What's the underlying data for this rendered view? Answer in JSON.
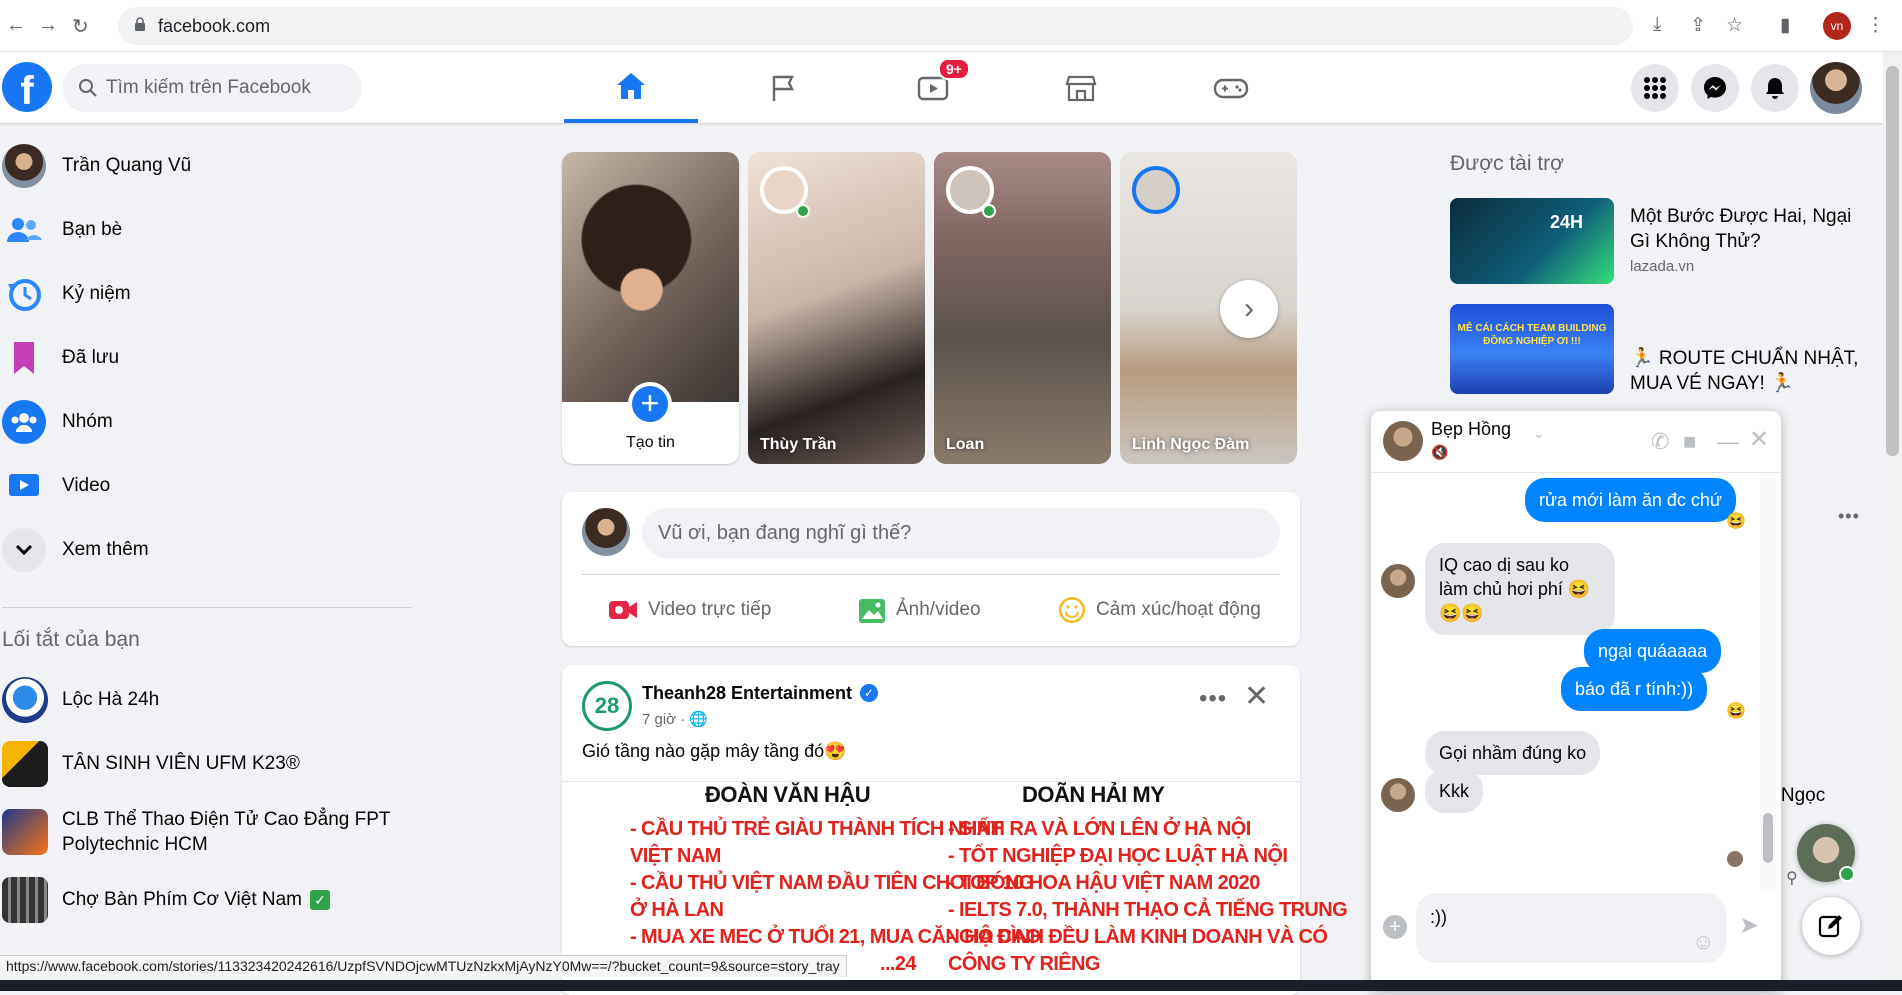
{
  "browser": {
    "url": "facebook.com",
    "profile_initials": "vn",
    "status_url": "https://www.facebook.com/stories/113323420242616/UzpfSVNDOjcwMTUzNzkxMjAyNzY0Mw==/?bucket_count=9&source=story_tray"
  },
  "topbar": {
    "search_placeholder": "Tìm kiếm trên Facebook",
    "video_badge": "9+",
    "logo_letter": "f"
  },
  "sidebar": {
    "items": [
      {
        "label": "Trần Quang Vũ",
        "icon": "profile-avatar"
      },
      {
        "label": "Bạn bè",
        "icon": "friends-icon"
      },
      {
        "label": "Kỷ niệm",
        "icon": "memories-icon"
      },
      {
        "label": "Đã lưu",
        "icon": "saved-icon"
      },
      {
        "label": "Nhóm",
        "icon": "groups-icon"
      },
      {
        "label": "Video",
        "icon": "video-icon"
      },
      {
        "label": "Xem thêm",
        "icon": "chevron-down-icon"
      }
    ],
    "shortcuts_title": "Lối tắt của bạn",
    "shortcuts": [
      {
        "label": "Lộc Hà 24h"
      },
      {
        "label": "TÂN SINH VIÊN UFM K23®"
      },
      {
        "label": "CLB Thể Thao Điện Tử Cao Đẳng FPT Polytechnic HCM"
      },
      {
        "label": "Chợ Bàn Phím Cơ Việt Nam"
      }
    ]
  },
  "stories": {
    "create_label": "Tạo tin",
    "items": [
      {
        "name": "Thùy Trần"
      },
      {
        "name": "Loan"
      },
      {
        "name": "Linh Ngọc Đàm"
      }
    ]
  },
  "composer": {
    "placeholder": "Vũ ơi, bạn đang nghĩ gì thế?",
    "actions": [
      "Video trực tiếp",
      "Ảnh/video",
      "Cảm xúc/hoạt động"
    ]
  },
  "post": {
    "author": "Theanh28 Entertainment",
    "avatar_text": "28",
    "time": "7 giờ · ",
    "text": "Gió tầng nào gặp mây tầng đó😍",
    "image": {
      "left_title": "ĐOÀN VĂN HẬU",
      "left_lines": [
        "- CẦU THỦ TRẺ GIÀU THÀNH TÍCH NHẤT",
        "VIỆT NAM",
        "- CẦU THỦ VIỆT NAM ĐẦU TIÊN CHƠI BÓNG",
        "Ở HÀ LAN",
        "- MUA XE MEC Ở TUỔI 21, MUA CĂN HỘ CAO",
        "...24"
      ],
      "right_title": "DOÃN HẢI MY",
      "right_lines": [
        "- SINH RA VÀ LỚN LÊN Ở HÀ NỘI",
        "- TỐT NGHIỆP ĐẠI HỌC LUẬT HÀ NỘI",
        "- TOP 10 HOA HẬU VIỆT NAM 2020",
        "- IELTS 7.0, THÀNH THẠO CẢ TIẾNG TRUNG",
        "- GIA ĐÌNH ĐỀU LÀM KINH DOANH VÀ CÓ",
        "CÔNG TY RIÊNG"
      ]
    }
  },
  "ads": {
    "title": "Được tài trợ",
    "items": [
      {
        "title": "Một Bước Được Hai, Ngại Gì Không Thử?",
        "source": "lazada.vn",
        "image_text": "24H"
      },
      {
        "title": "🏃 ROUTE CHUẨN NHẬT, MUA VÉ NGAY! 🏃",
        "source": "",
        "image_text": "MÊ CÁI CÁCH TEAM BUILDING ĐỒNG NGHIỆP ƠI !!!"
      }
    ],
    "partial_text": "g Ngọc"
  },
  "chat": {
    "name": "Bẹp Hồng",
    "messages": [
      {
        "dir": "out",
        "text": "rửa mới làm ăn đc chứ",
        "reaction": "😆"
      },
      {
        "dir": "in",
        "text": "IQ cao dị sau ko làm chủ hơi phí 😆😆😆"
      },
      {
        "dir": "out",
        "text": "ngại quáaaaa"
      },
      {
        "dir": "out",
        "text": "báo đã r tính:))",
        "reaction": "😆"
      },
      {
        "dir": "in",
        "text": "Gọi nhầm đúng ko"
      },
      {
        "dir": "in",
        "text": "Kkk"
      }
    ],
    "input_value": ":))"
  }
}
